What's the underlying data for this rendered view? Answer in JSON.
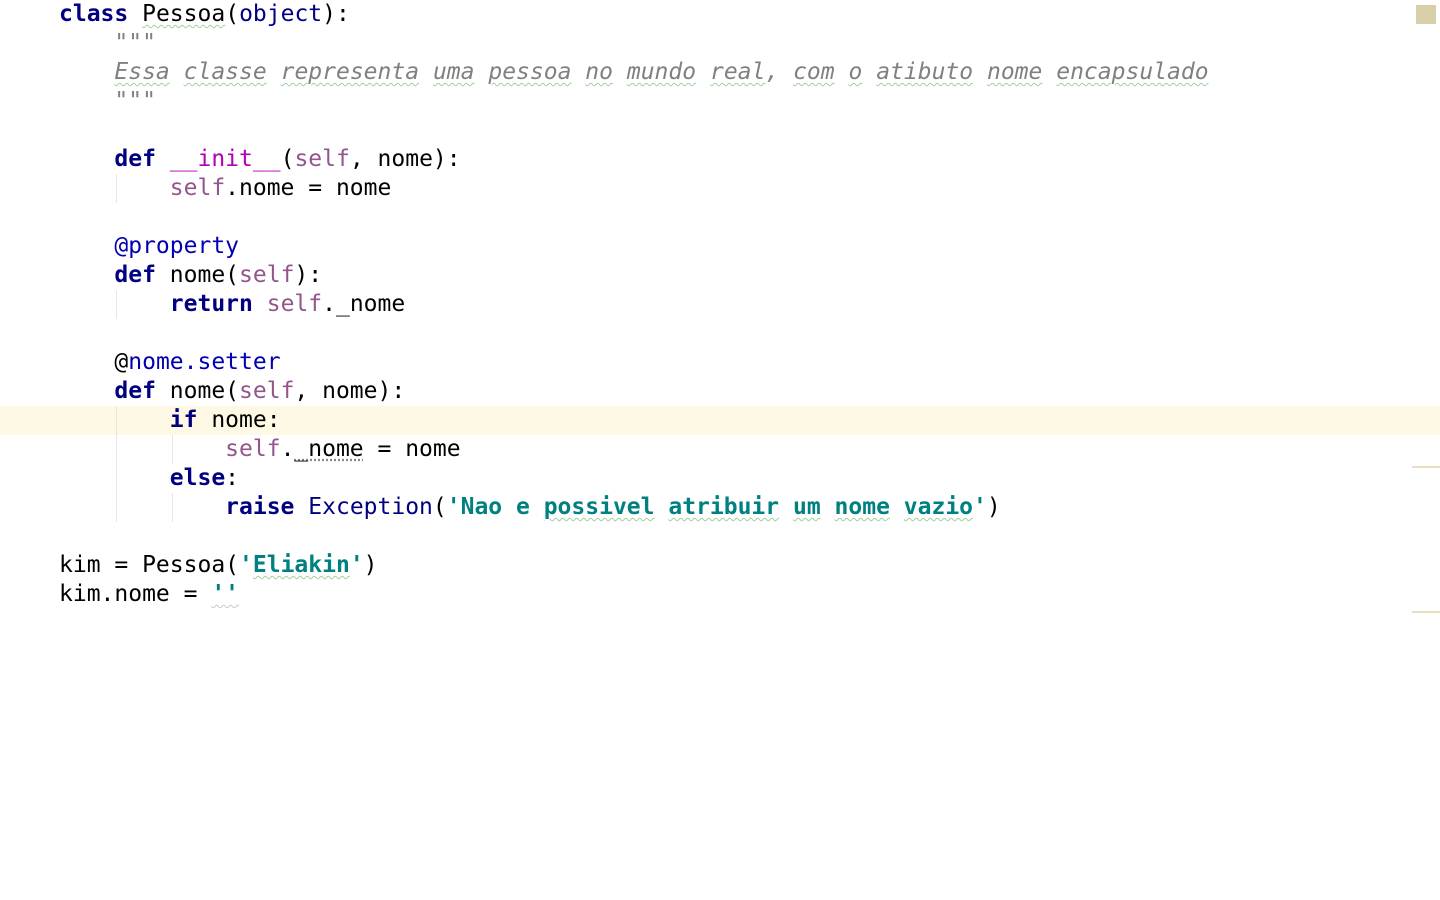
{
  "editor": {
    "lines": [
      {
        "tokens": [
          {
            "t": "class",
            "c": "kw"
          },
          {
            "t": " "
          },
          {
            "t": "Pessoa",
            "c": "typo"
          },
          {
            "t": "("
          },
          {
            "t": "object",
            "c": "builtin"
          },
          {
            "t": "):"
          }
        ]
      },
      {
        "tokens": [
          {
            "t": "    \"\"\"",
            "c": "doc"
          }
        ]
      },
      {
        "tokens": [
          {
            "t": "    "
          },
          {
            "t": "Essa",
            "c": "doc typo"
          },
          {
            "t": " ",
            "c": "doc"
          },
          {
            "t": "classe",
            "c": "doc typo"
          },
          {
            "t": " ",
            "c": "doc"
          },
          {
            "t": "representa",
            "c": "doc typo"
          },
          {
            "t": " ",
            "c": "doc"
          },
          {
            "t": "uma",
            "c": "doc typo"
          },
          {
            "t": " ",
            "c": "doc"
          },
          {
            "t": "pessoa",
            "c": "doc typo"
          },
          {
            "t": " ",
            "c": "doc"
          },
          {
            "t": "no",
            "c": "doc typo"
          },
          {
            "t": " ",
            "c": "doc"
          },
          {
            "t": "mundo",
            "c": "doc typo"
          },
          {
            "t": " ",
            "c": "doc"
          },
          {
            "t": "real",
            "c": "doc typo"
          },
          {
            "t": ", ",
            "c": "doc"
          },
          {
            "t": "com",
            "c": "doc typo"
          },
          {
            "t": " ",
            "c": "doc"
          },
          {
            "t": "o",
            "c": "doc typo"
          },
          {
            "t": " ",
            "c": "doc"
          },
          {
            "t": "atibuto",
            "c": "doc typo"
          },
          {
            "t": " ",
            "c": "doc"
          },
          {
            "t": "nome",
            "c": "doc typo"
          },
          {
            "t": " ",
            "c": "doc"
          },
          {
            "t": "encapsulado",
            "c": "doc typo"
          }
        ]
      },
      {
        "tokens": [
          {
            "t": "    \"\"\"",
            "c": "doc"
          }
        ]
      },
      {
        "tokens": []
      },
      {
        "tokens": [
          {
            "t": "    "
          },
          {
            "t": "def",
            "c": "kw"
          },
          {
            "t": " "
          },
          {
            "t": "__init__",
            "c": "magic"
          },
          {
            "t": "("
          },
          {
            "t": "self",
            "c": "self"
          },
          {
            "t": ", nome):"
          }
        ]
      },
      {
        "tokens": [
          {
            "t": "        "
          },
          {
            "t": "self",
            "c": "self"
          },
          {
            "t": ".nome = nome"
          }
        ]
      },
      {
        "tokens": []
      },
      {
        "tokens": [
          {
            "t": "    "
          },
          {
            "t": "@property",
            "c": "deco"
          }
        ]
      },
      {
        "tokens": [
          {
            "t": "    "
          },
          {
            "t": "def",
            "c": "kw"
          },
          {
            "t": " nome("
          },
          {
            "t": "self",
            "c": "self"
          },
          {
            "t": "):"
          }
        ]
      },
      {
        "tokens": [
          {
            "t": "        "
          },
          {
            "t": "return",
            "c": "kw"
          },
          {
            "t": " "
          },
          {
            "t": "self",
            "c": "self"
          },
          {
            "t": "._nome"
          }
        ]
      },
      {
        "tokens": []
      },
      {
        "tokens": [
          {
            "t": "    @"
          },
          {
            "t": "nome.setter",
            "c": "deco"
          }
        ]
      },
      {
        "tokens": [
          {
            "t": "    "
          },
          {
            "t": "def",
            "c": "kw"
          },
          {
            "t": " nome("
          },
          {
            "t": "self",
            "c": "self"
          },
          {
            "t": ", nome):"
          }
        ]
      },
      {
        "tokens": [
          {
            "t": "        "
          },
          {
            "t": "if",
            "c": "kw"
          },
          {
            "t": " nome:"
          }
        ],
        "current": true
      },
      {
        "tokens": [
          {
            "t": "            "
          },
          {
            "t": "self",
            "c": "self"
          },
          {
            "t": "."
          },
          {
            "t": "_nome",
            "c": "dotted"
          },
          {
            "t": " = nome"
          }
        ]
      },
      {
        "tokens": [
          {
            "t": "        "
          },
          {
            "t": "else",
            "c": "kw"
          },
          {
            "t": ":"
          }
        ]
      },
      {
        "tokens": [
          {
            "t": "            "
          },
          {
            "t": "raise",
            "c": "kw"
          },
          {
            "t": " "
          },
          {
            "t": "Exception",
            "c": "builtin"
          },
          {
            "t": "("
          },
          {
            "t": "'Nao e ",
            "c": "str"
          },
          {
            "t": "possivel",
            "c": "str typo"
          },
          {
            "t": " ",
            "c": "str"
          },
          {
            "t": "atribuir",
            "c": "str typo"
          },
          {
            "t": " ",
            "c": "str"
          },
          {
            "t": "um",
            "c": "str typo"
          },
          {
            "t": " ",
            "c": "str"
          },
          {
            "t": "nome",
            "c": "str typo"
          },
          {
            "t": " ",
            "c": "str"
          },
          {
            "t": "vazio",
            "c": "str typo"
          },
          {
            "t": "'",
            "c": "str"
          },
          {
            "t": ")"
          }
        ]
      },
      {
        "tokens": []
      },
      {
        "tokens": [
          {
            "t": "kim = Pessoa("
          },
          {
            "t": "'",
            "c": "str"
          },
          {
            "t": "Eliakin",
            "c": "str typo"
          },
          {
            "t": "'",
            "c": "str"
          },
          {
            "t": ")"
          }
        ]
      },
      {
        "tokens": [
          {
            "t": "kim.nome = "
          },
          {
            "t": "''",
            "c": "str warn"
          }
        ]
      }
    ]
  }
}
